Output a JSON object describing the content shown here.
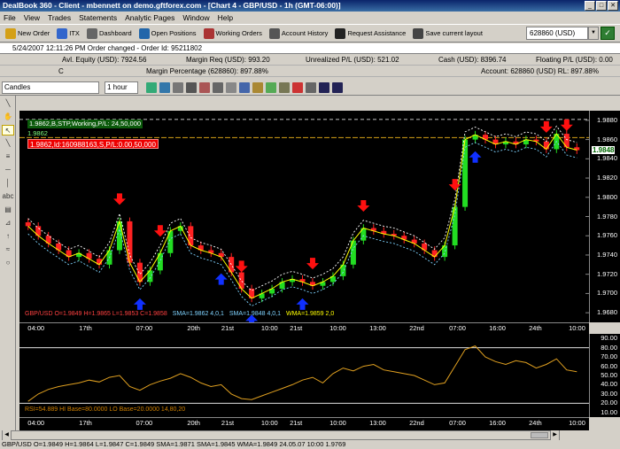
{
  "window": {
    "title": "DealBook 360 - Client - mbennett on demo.gftforex.com - [Chart 4 - GBP/USD - 1h (GMT-06:00)]",
    "buttons": [
      "_",
      "□",
      "✕"
    ]
  },
  "menu": [
    "File",
    "View",
    "Trades",
    "Statements",
    "Analytic Pages",
    "Window",
    "Help"
  ],
  "toolbar": {
    "items": [
      {
        "label": "New Order",
        "icon": "new-order-icon",
        "color": "#d4a017"
      },
      {
        "label": "ITX",
        "icon": "itx-icon",
        "color": "#3366cc"
      },
      {
        "label": "Dashboard",
        "icon": "dashboard-icon",
        "color": "#666666"
      },
      {
        "label": "Open Positions",
        "icon": "positions-icon",
        "color": "#2266aa"
      },
      {
        "label": "Working Orders",
        "icon": "orders-icon",
        "color": "#aa3333"
      },
      {
        "label": "Account History",
        "icon": "history-icon",
        "color": "#555555"
      },
      {
        "label": "Request Assistance",
        "icon": "assistance-icon",
        "color": "#222222"
      },
      {
        "label": "Save current layout",
        "icon": "save-icon",
        "color": "#444444"
      }
    ],
    "account_value": "628860 (USD)"
  },
  "status_line": "5/24/2007 12:11:26 PM Order changed - Order Id: 95211802",
  "account_rows": [
    {
      "left": "Avl. Equity (USD): 7924.56",
      "c2": "Margin Req (USD): 993.20",
      "c3": "Unrealized P/L (USD): 521.02",
      "c4": "Cash (USD): 8396.74",
      "c5": "Floating P/L (USD): 0.00"
    },
    {
      "left": "C",
      "c2": "Margin Percentage (628860): 897.88%",
      "c3": "",
      "c4": "",
      "c5": "Account: 628860 (USD) RL: 897.88%"
    }
  ],
  "chart_controls": {
    "type": "Candles",
    "interval": "1 hour"
  },
  "orders": {
    "order1": "1.9862,B,STP,Working,P/L: 24,50,000",
    "price1": "1.9862",
    "order2": "1.9862,Id:160988163,S,P/L:0.00,50,000"
  },
  "legend": {
    "ohlc": "GBP/USD O=1.9849 H=1.9865 L=1.9853 C=1.9858",
    "sma1": "SMA=1.9862  4,0,1",
    "sma2": "SMA=1.9848  4,0,1",
    "wma": "WMA=1.9859  2,0"
  },
  "rsi_legend": "RSI=54.889  HI Base=80.0000  LO Base=20.0000  14,80,20",
  "bottom_status": "GBP/USD O=1.9849 H=1.9864 L=1.9847 C=1.9849  SMA=1.9871 SMA=1.9845 WMA=1.9849  24.05.07 10:00 1.9769",
  "colors": {
    "up": "#22dd22",
    "down": "#ff2222",
    "bg": "#000000",
    "sma1": "#7fd3ff",
    "wma": "#ffff00",
    "rsi": "#e0a020"
  },
  "chart_data": [
    {
      "type": "candlestick",
      "title": "Chart 4 - GBP/USD - 1h (GMT-06:00)",
      "y_ticks": [
        "1.9880",
        "1.9860",
        "1.9840",
        "1.9820",
        "1.9800",
        "1.9780",
        "1.9760",
        "1.9740",
        "1.9720",
        "1.9700",
        "1.9680"
      ],
      "ylim": [
        1.967,
        1.989
      ],
      "last_price": "1.9848",
      "x_ticks": [
        "04:00",
        "17th",
        "07:00",
        "20th",
        "21st",
        "10:00",
        "21st",
        "10:00",
        "13:00",
        "22nd",
        "07:00",
        "16:00",
        "24th",
        "10:00"
      ],
      "x_tick_pct": [
        3,
        12,
        22,
        31,
        37,
        44,
        49,
        56,
        63,
        70,
        77,
        84,
        91,
        98
      ],
      "close": [
        1.977,
        1.976,
        1.9752,
        1.9745,
        1.9738,
        1.9742,
        1.9736,
        1.973,
        1.9745,
        1.9775,
        1.9732,
        1.9712,
        1.9724,
        1.9742,
        1.9765,
        1.977,
        1.975,
        1.9745,
        1.9742,
        1.9738,
        1.9722,
        1.9705,
        1.9695,
        1.97,
        1.9705,
        1.9712,
        1.9715,
        1.9712,
        1.9708,
        1.9712,
        1.9718,
        1.973,
        1.9755,
        1.9768,
        1.9765,
        1.9762,
        1.976,
        1.9756,
        1.9752,
        1.9745,
        1.9738,
        1.975,
        1.979,
        1.986,
        1.9865,
        1.986,
        1.9855,
        1.9858,
        1.9855,
        1.986,
        1.9858,
        1.985,
        1.9866,
        1.9852,
        1.9849
      ],
      "arrows_down_index": [
        9,
        13,
        21,
        28,
        33,
        42,
        51,
        53
      ],
      "arrows_up_index": [
        11,
        19,
        22,
        27,
        44
      ]
    },
    {
      "type": "line",
      "title": "RSI",
      "y_ticks": [
        "90.00",
        "80.00",
        "70.00",
        "60.00",
        "50.00",
        "40.00",
        "30.00",
        "20.00",
        "10.00"
      ],
      "ylim": [
        5,
        95
      ],
      "base_lines": [
        80,
        20
      ],
      "values": [
        22,
        30,
        35,
        38,
        40,
        42,
        45,
        43,
        48,
        50,
        38,
        34,
        40,
        44,
        47,
        52,
        48,
        42,
        38,
        40,
        30,
        25,
        24,
        28,
        32,
        36,
        40,
        45,
        48,
        42,
        52,
        58,
        55,
        60,
        62,
        56,
        54,
        52,
        50,
        45,
        40,
        42,
        60,
        78,
        82,
        70,
        65,
        62,
        66,
        64,
        58,
        62,
        68,
        56,
        54
      ]
    }
  ]
}
